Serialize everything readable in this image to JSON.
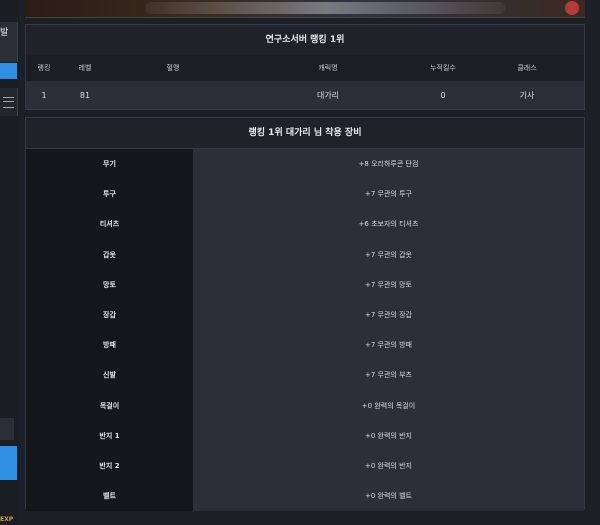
{
  "sidebar": {
    "panel_text": "발",
    "exp_label": "EXP"
  },
  "ranking_card": {
    "title": "연구소서버 랭킹 1위",
    "columns": [
      "랭킹",
      "레벨",
      "혈맹",
      "캐릭명",
      "누적킬수",
      "클래스"
    ],
    "row": {
      "rank": "1",
      "level": "81",
      "clan": "",
      "character": "대가리",
      "kills": "0",
      "class": "기사"
    }
  },
  "equipment_card": {
    "title": "랭킹 1위 대가리 님 착용 장비",
    "items": [
      {
        "slot": "무기",
        "item": "+8 오리하루콘 단검"
      },
      {
        "slot": "투구",
        "item": "+7 무관의 투구"
      },
      {
        "slot": "티셔츠",
        "item": "+6 초보자의 티셔츠"
      },
      {
        "slot": "갑옷",
        "item": "+7 무관의 갑옷"
      },
      {
        "slot": "망토",
        "item": "+7 무관의 망토"
      },
      {
        "slot": "장갑",
        "item": "+7 무관의 장갑"
      },
      {
        "slot": "방패",
        "item": "+7 무관의 방패"
      },
      {
        "slot": "신발",
        "item": "+7 무관의 부츠"
      },
      {
        "slot": "목걸이",
        "item": "+0 완력의 목걸이"
      },
      {
        "slot": "반지 1",
        "item": "+0 완력의 반지"
      },
      {
        "slot": "반지 2",
        "item": "+0 완력의 반지"
      },
      {
        "slot": "벨트",
        "item": "+0 완력의 벨트"
      }
    ]
  },
  "icons": {
    "menu": "hamburger-menu-icon"
  }
}
